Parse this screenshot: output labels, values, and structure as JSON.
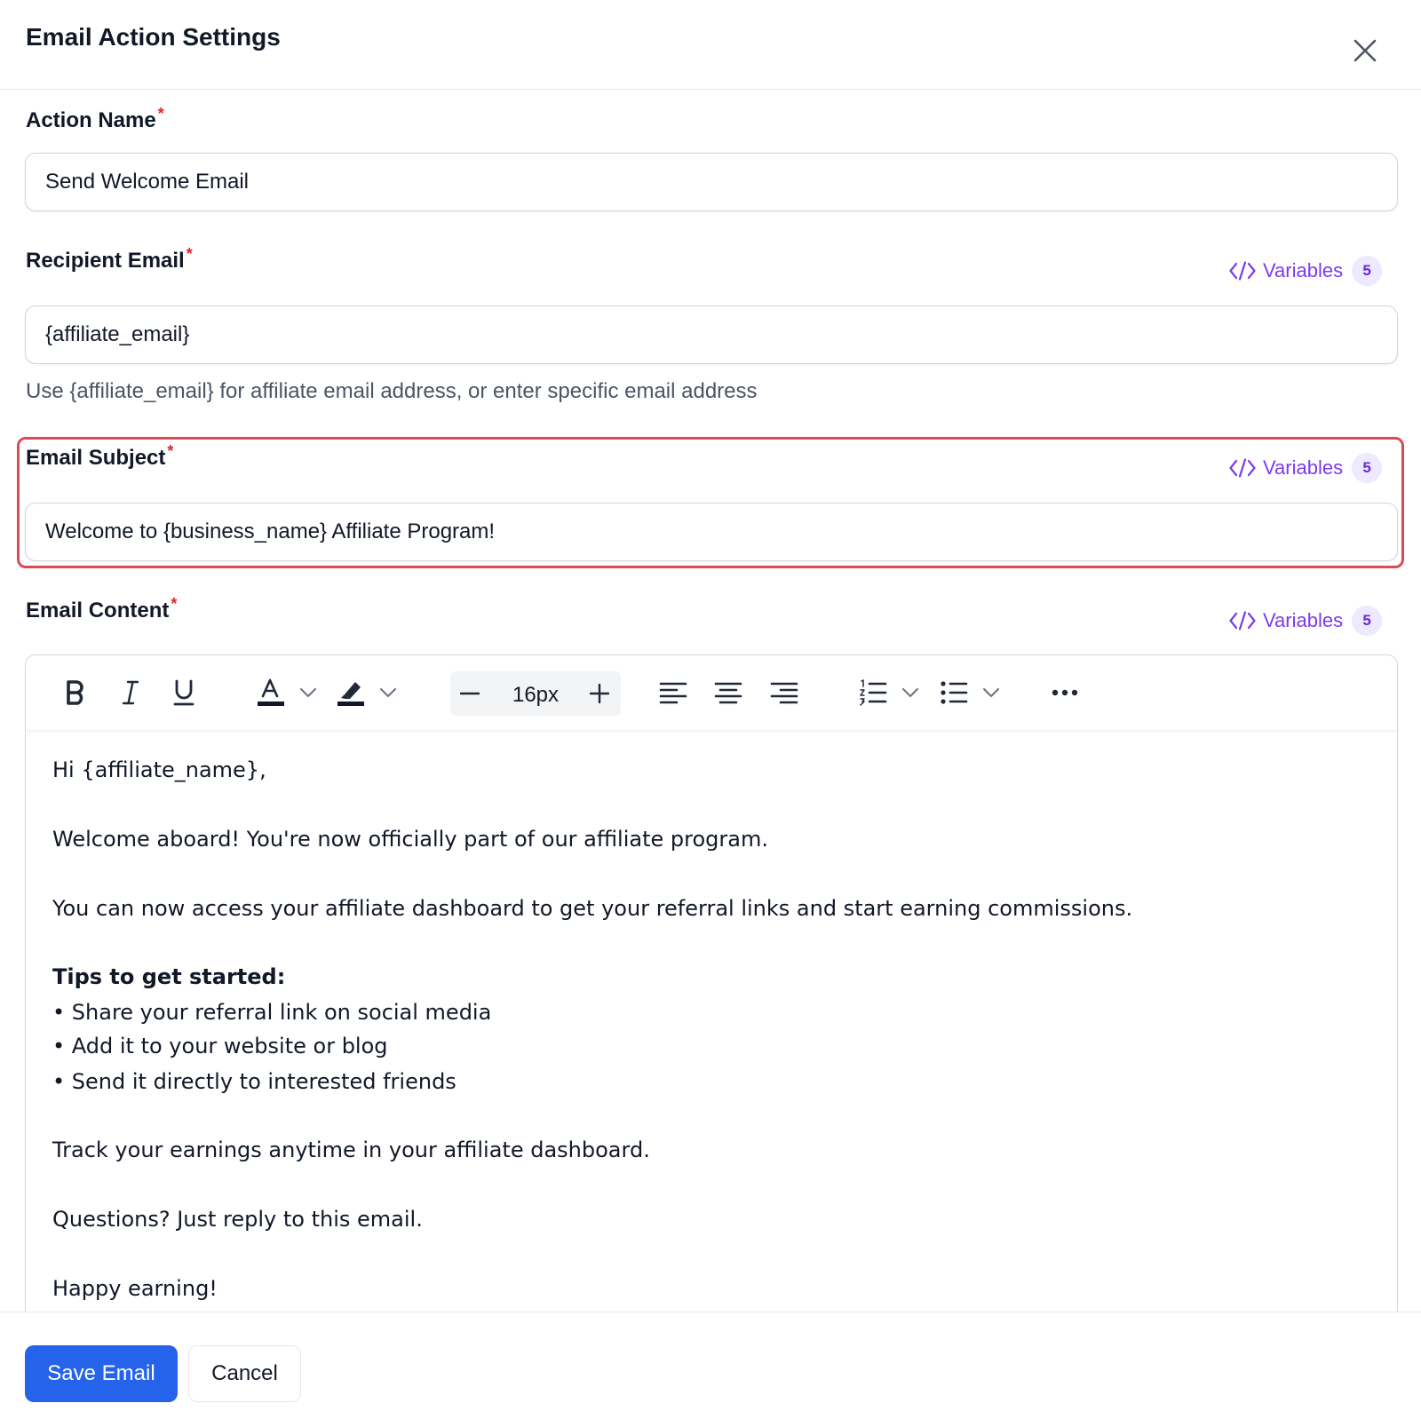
{
  "modal": {
    "title": "Email Action Settings",
    "close_icon": "close-icon"
  },
  "fields": {
    "action_name": {
      "label": "Action Name",
      "required_mark": "*",
      "value": "Send Welcome Email"
    },
    "recipient_email": {
      "label": "Recipient Email",
      "required_mark": "*",
      "value": "{affiliate_email}",
      "hint": "Use {affiliate_email} for affiliate email address, or enter specific email address",
      "variables_label": "Variables",
      "variables_count": "5"
    },
    "email_subject": {
      "label": "Email Subject",
      "required_mark": "*",
      "value": "Welcome to {business_name} Affiliate Program!",
      "variables_label": "Variables",
      "variables_count": "5"
    },
    "email_content": {
      "label": "Email Content",
      "required_mark": "*",
      "variables_label": "Variables",
      "variables_count": "5"
    }
  },
  "toolbar": {
    "font_size": "16px",
    "icons": [
      "bold-icon",
      "italic-icon",
      "underline-icon",
      "text-color-icon",
      "highlight-icon",
      "minus-icon",
      "plus-icon",
      "align-left-icon",
      "align-center-icon",
      "align-right-icon",
      "ordered-list-icon",
      "bullet-list-icon",
      "more-icon"
    ]
  },
  "editor_content": {
    "greeting": "Hi {affiliate_name},",
    "welcome": "Welcome aboard! You're now officially part of our affiliate program.",
    "access": "You can now access your affiliate dashboard to get your referral links and start earning commissions.",
    "tips_heading": "Tips to get started:",
    "tips": [
      "• Share your referral link on social media",
      "• Add it to your website or blog",
      "• Send it directly to interested friends"
    ],
    "track": "Track your earnings anytime in your affiliate dashboard.",
    "questions": "Questions? Just reply to this email.",
    "signoff": "Happy earning!"
  },
  "footer": {
    "save_label": "Save Email",
    "cancel_label": "Cancel"
  },
  "colors": {
    "accent_purple": "#7c3aed",
    "primary_blue": "#2563eb",
    "required_red": "#dc2626",
    "highlight_red": "#dc4a55"
  }
}
